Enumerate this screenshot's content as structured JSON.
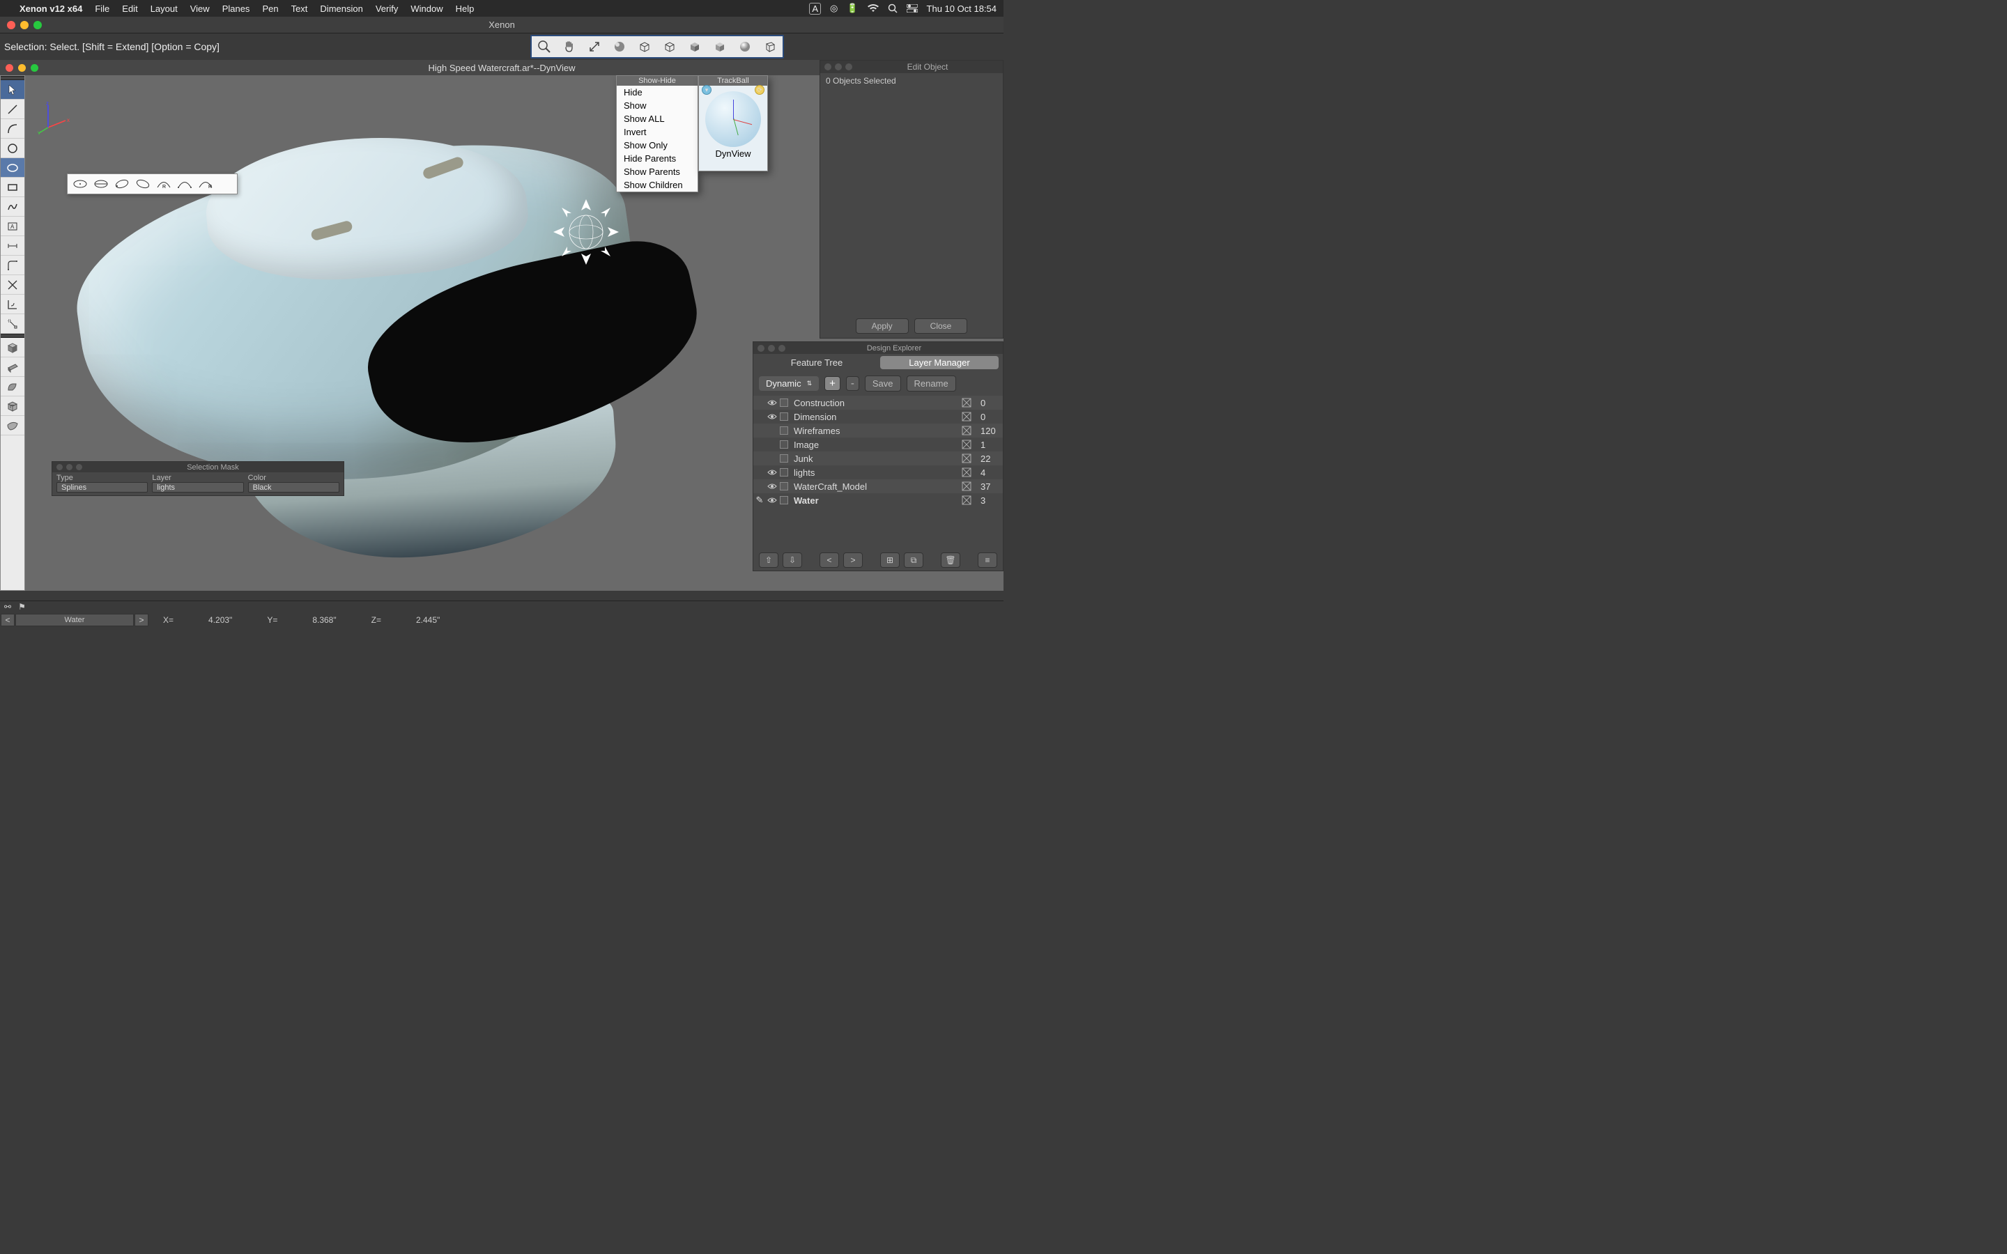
{
  "menubar": {
    "app_name": "Xenon v12 x64",
    "items": [
      "File",
      "Edit",
      "Layout",
      "View",
      "Planes",
      "Pen",
      "Text",
      "Dimension",
      "Verify",
      "Window",
      "Help"
    ],
    "input_indicator": "A",
    "datetime": "Thu 10 Oct  18:54"
  },
  "app_window": {
    "title": "Xenon"
  },
  "prompt": {
    "text": "Selection: Select. [Shift = Extend] [Option = Copy]"
  },
  "document": {
    "title": "High Speed Watercraft.ar*--DynView"
  },
  "show_hide": {
    "title": "Show-Hide",
    "items": [
      "Hide",
      "Show",
      "Show ALL",
      "Invert",
      "Show Only",
      "Hide Parents",
      "Show Parents",
      "Show Children"
    ]
  },
  "trackball": {
    "title": "TrackBall",
    "label": "DynView"
  },
  "edit_object": {
    "title": "Edit Object",
    "status": "0 Objects Selected",
    "apply": "Apply",
    "close": "Close"
  },
  "design_explorer": {
    "title": "Design Explorer",
    "tabs": {
      "feature": "Feature Tree",
      "layer": "Layer Manager"
    },
    "dropdown": "Dynamic",
    "plus": "+",
    "minus": "-",
    "save": "Save",
    "rename": "Rename",
    "layers": [
      {
        "name": "Construction",
        "count": 0,
        "visible": true
      },
      {
        "name": "Dimension",
        "count": 0,
        "visible": true
      },
      {
        "name": "Wireframes",
        "count": 120,
        "visible": false
      },
      {
        "name": "Image",
        "count": 1,
        "visible": false
      },
      {
        "name": "Junk",
        "count": 22,
        "visible": false
      },
      {
        "name": "lights",
        "count": 4,
        "visible": true
      },
      {
        "name": "WaterCraft_Model",
        "count": 37,
        "visible": true
      },
      {
        "name": "Water",
        "count": 3,
        "visible": true,
        "active": true
      }
    ]
  },
  "selection_mask": {
    "title": "Selection Mask",
    "type_label": "Type",
    "type_value": "Splines",
    "layer_label": "Layer",
    "layer_value": "lights",
    "color_label": "Color",
    "color_value": "Black"
  },
  "status_bar": {
    "current_layer": "Water",
    "x_label": "X=",
    "x_value": "4.203\"",
    "y_label": "Y=",
    "y_value": "8.368\"",
    "z_label": "Z=",
    "z_value": "2.445\""
  }
}
